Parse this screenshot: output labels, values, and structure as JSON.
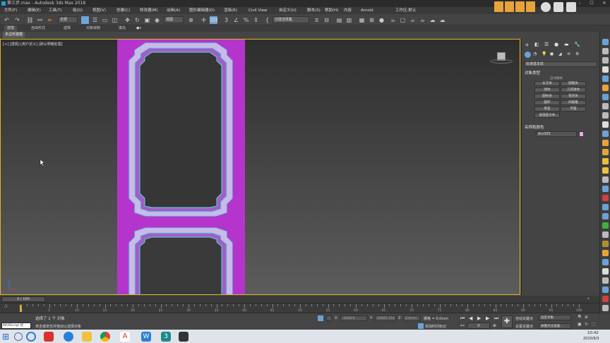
{
  "window": {
    "title": "第三步.max - Autodesk 3ds Max 2018",
    "controls": {
      "min": "–",
      "max": "☐",
      "close": "✕"
    }
  },
  "menus": [
    "文件(F)",
    "编辑(E)",
    "工具(T)",
    "组(G)",
    "视图(V)",
    "创建(C)",
    "修改器(M)",
    "动画(A)",
    "图形编辑器(D)",
    "渲染(R)",
    "Civil View",
    "自定义(U)",
    "脚本(S)",
    "帮助(H)",
    "内容",
    "Arnold"
  ],
  "workspace_area": "工作区:默认",
  "toolbar": {
    "undo": "undo-icon",
    "redo": "redo-icon",
    "selection_filter": "全部",
    "ref_coord": "视图",
    "named_selection": "创建选择集"
  },
  "ribbon": {
    "tabs": [
      "建模",
      "自由形式",
      "选择",
      "对象绘制",
      "填充"
    ],
    "subtab": "多边形建模"
  },
  "viewport": {
    "label": "[+] [透视] [用户定义] [默认明暗处理]",
    "accent_color": "#e6b325",
    "door_color": "#b535cc",
    "frame_line_color": "#5fd6e8"
  },
  "command_panel": {
    "category": "标准基本体",
    "object_type_header": "对象类型",
    "autogrid": "自动栅格",
    "buttons": [
      "长方体",
      "圆锥体",
      "球体",
      "几何球体",
      "圆柱体",
      "管状体",
      "圆环",
      "四棱锥",
      "茶壶",
      "平面",
      "加强型文本"
    ],
    "name_color_header": "名称和颜色",
    "object_name": "Arc005",
    "object_color": "#e7a8f0"
  },
  "timeline": {
    "frame_display": "0 / 100",
    "ticks": [
      0,
      5,
      10,
      15,
      20,
      25,
      30,
      35,
      40,
      45,
      50,
      55,
      60,
      65,
      70,
      75,
      80,
      85,
      90,
      95,
      100
    ]
  },
  "status": {
    "maxscript": "MAXScript 侦",
    "selected": "选择了 1 个 对象",
    "hint": "单击或单击并拖动以选择对象",
    "x_label": "X:",
    "x_value": "-2606.9",
    "y_label": "Y:",
    "y_value": "10005.754",
    "z_label": "Z:",
    "z_value": "0.0mm",
    "grid": "栅格 = 0.0mm",
    "add_time_tag": "添加时间标记",
    "auto_key": "自动关键点",
    "selected_obj": "选定对象",
    "set_key": "设置关键点",
    "key_filters": "关键点过滤器...",
    "frame": "0"
  },
  "taskbar": {
    "time": "10:42",
    "date": "2020/9/3"
  }
}
